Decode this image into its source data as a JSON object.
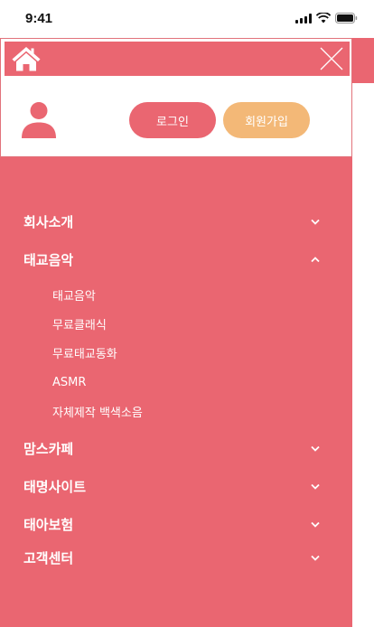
{
  "status_bar": {
    "time": "9:41"
  },
  "header": {
    "home_icon": "home-icon",
    "close_icon": "close-icon"
  },
  "auth": {
    "login_label": "로그인",
    "signup_label": "회원가입"
  },
  "menu": {
    "items": [
      {
        "label": "회사소개",
        "expanded": false
      },
      {
        "label": "태교음악",
        "expanded": true,
        "children": [
          "태교음악",
          "무료클래식",
          "무료태교동화",
          "ASMR",
          "자체제작 백색소음"
        ]
      },
      {
        "label": "맘스카페",
        "expanded": false
      },
      {
        "label": "태명사이트",
        "expanded": false
      },
      {
        "label": "태아보험",
        "expanded": false
      },
      {
        "label": "고객센터",
        "expanded": false
      }
    ]
  },
  "colors": {
    "primary": "#ea6671",
    "accent": "#f3b877",
    "text_on_primary": "#ffffff"
  }
}
